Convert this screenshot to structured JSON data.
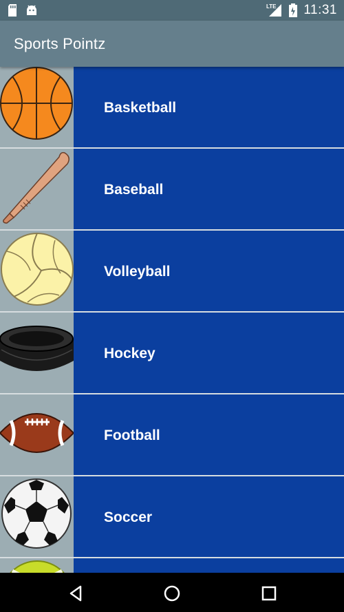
{
  "status_bar": {
    "time": "11:31",
    "network": "LTE",
    "icons": [
      "sd-card-icon",
      "android-icon",
      "lte-signal-icon",
      "battery-icon"
    ]
  },
  "app_bar": {
    "title": "Sports Pointz"
  },
  "sports": [
    {
      "label": "Basketball",
      "icon": "basketball-icon"
    },
    {
      "label": "Baseball",
      "icon": "baseball-bat-icon"
    },
    {
      "label": "Volleyball",
      "icon": "volleyball-icon"
    },
    {
      "label": "Hockey",
      "icon": "hockey-puck-icon"
    },
    {
      "label": "Football",
      "icon": "football-icon"
    },
    {
      "label": "Soccer",
      "icon": "soccer-ball-icon"
    },
    {
      "label": "",
      "icon": "tennis-ball-icon"
    }
  ],
  "nav_bar": {
    "icons": [
      "back-icon",
      "home-icon",
      "recents-icon"
    ]
  },
  "colors": {
    "status_bar": "#4f6a76",
    "app_bar": "#657f8c",
    "row_background": "#0b3f9f",
    "thumb_background": "#9cadb3",
    "divider": "#d7dde0"
  }
}
